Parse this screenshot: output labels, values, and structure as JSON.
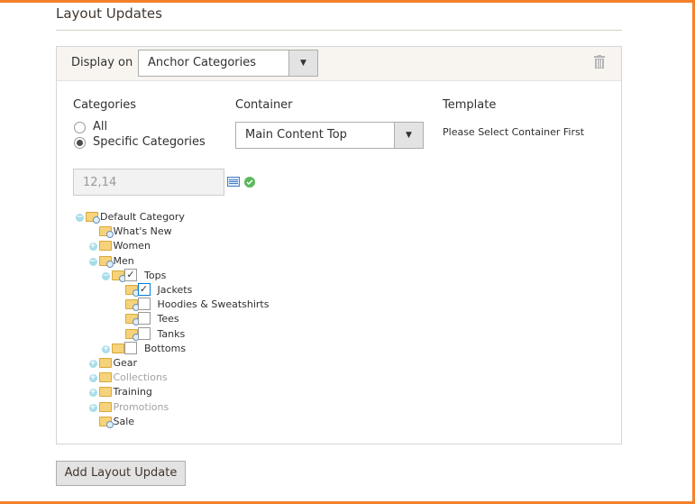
{
  "section_title": "Layout Updates",
  "display_on": {
    "label": "Display on",
    "value": "Anchor Categories"
  },
  "categories": {
    "label": "Categories",
    "options": [
      {
        "label": "All",
        "selected": false
      },
      {
        "label": "Specific Categories",
        "selected": true
      }
    ],
    "input_value": "12,14"
  },
  "container": {
    "label": "Container",
    "value": "Main Content Top"
  },
  "template": {
    "label": "Template",
    "message": "Please Select Container First"
  },
  "tree": [
    {
      "label": "Default Category",
      "level": 0,
      "toggle": "minus",
      "leaf": true
    },
    {
      "label": "What's New",
      "level": 1,
      "toggle": null,
      "leaf": true
    },
    {
      "label": "Women",
      "level": 1,
      "toggle": "plus",
      "leaf": false
    },
    {
      "label": "Men",
      "level": 1,
      "toggle": "minus",
      "leaf": true
    },
    {
      "label": "Tops",
      "level": 2,
      "toggle": "minus",
      "leaf": true,
      "checked": true
    },
    {
      "label": "Jackets",
      "level": 3,
      "toggle": null,
      "leaf": true,
      "checked": true
    },
    {
      "label": "Hoodies & Sweatshirts",
      "level": 3,
      "toggle": null,
      "leaf": true,
      "checked": false
    },
    {
      "label": "Tees",
      "level": 3,
      "toggle": null,
      "leaf": true,
      "checked": false
    },
    {
      "label": "Tanks",
      "level": 3,
      "toggle": null,
      "leaf": true,
      "checked": false
    },
    {
      "label": "Bottoms",
      "level": 2,
      "toggle": "plus",
      "leaf": false,
      "checked": false
    },
    {
      "label": "Gear",
      "level": 1,
      "toggle": "plus",
      "leaf": false
    },
    {
      "label": "Collections",
      "level": 1,
      "toggle": "plus",
      "leaf": false,
      "disabled": true
    },
    {
      "label": "Training",
      "level": 1,
      "toggle": "plus",
      "leaf": false
    },
    {
      "label": "Promotions",
      "level": 1,
      "toggle": "plus",
      "leaf": false,
      "disabled": true
    },
    {
      "label": "Sale",
      "level": 1,
      "toggle": null,
      "leaf": true
    }
  ],
  "add_button": "Add Layout Update",
  "colors": {
    "accent": "#f5802a",
    "header_bg": "#f8f5f0"
  }
}
